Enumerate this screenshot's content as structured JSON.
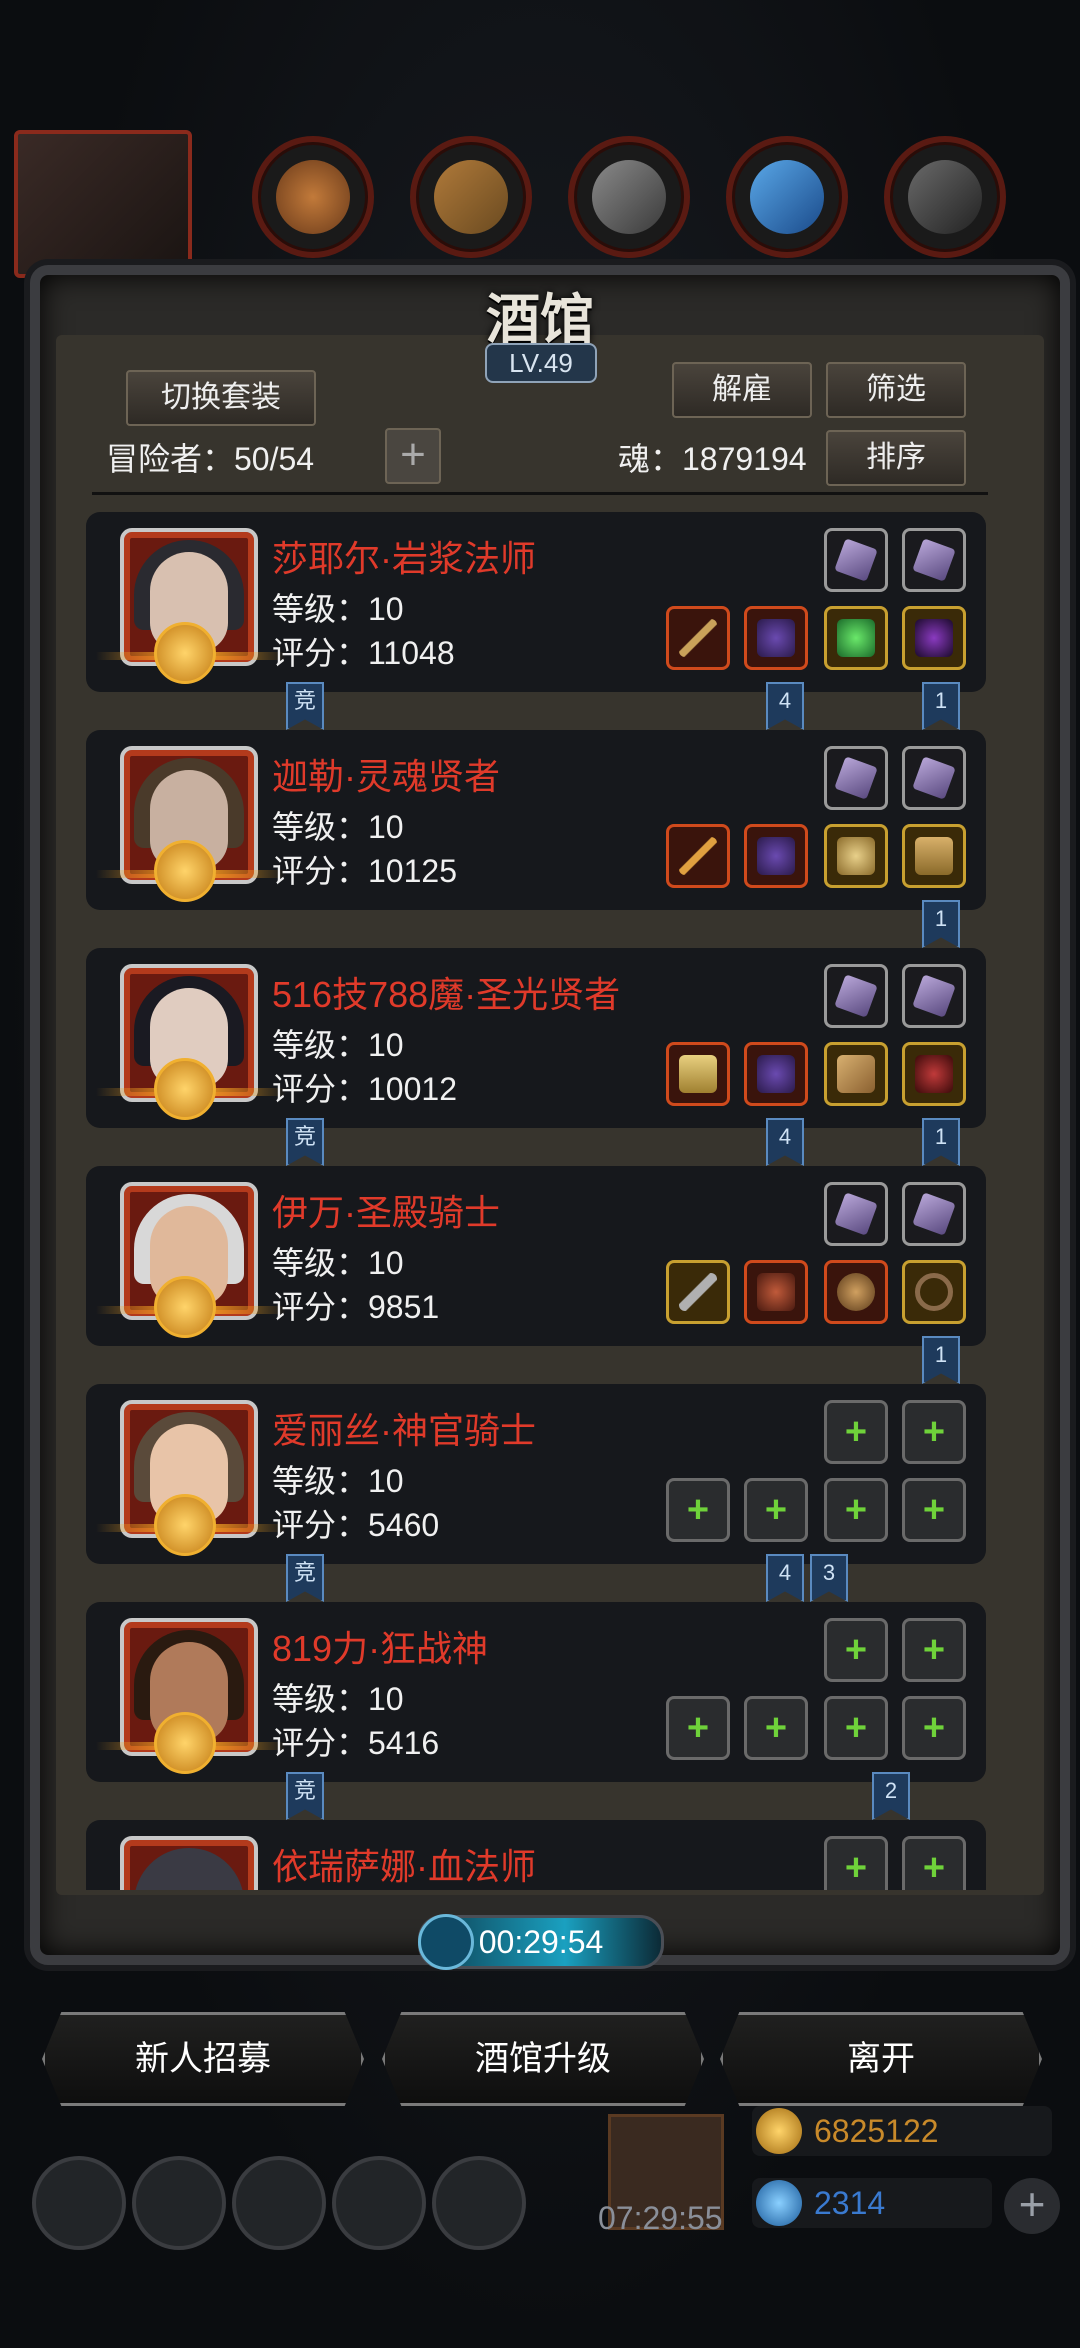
{
  "panel": {
    "title": "酒馆",
    "level": "LV.49",
    "switch_outfit": "切换套装",
    "dismiss": "解雇",
    "filter": "筛选",
    "sort": "排序",
    "adventurers_label": "冒险者：50/54",
    "soul_label": "魂：1879194"
  },
  "heroes": [
    {
      "name": "莎耶尔·岩浆法师",
      "level": "等级：10",
      "score": "评分：11048",
      "tags": [
        "竞",
        "4",
        "1"
      ]
    },
    {
      "name": "迦勒·灵魂贤者",
      "level": "等级：10",
      "score": "评分：10125",
      "tags": [
        "1"
      ]
    },
    {
      "name": "516技788魔·圣光贤者",
      "level": "等级：10",
      "score": "评分：10012",
      "tags": [
        "竞",
        "4",
        "1"
      ]
    },
    {
      "name": "伊万·圣殿骑士",
      "level": "等级：10",
      "score": "评分：9851",
      "tags": [
        "1"
      ]
    },
    {
      "name": "爱丽丝·神官骑士",
      "level": "等级：10",
      "score": "评分：5460",
      "tags": [
        "竞",
        "4",
        "3"
      ]
    },
    {
      "name": "819力·狂战神",
      "level": "等级：10",
      "score": "评分：5416",
      "tags": [
        "竞",
        "2"
      ]
    },
    {
      "name": "依瑞萨娜·血法师",
      "level": "",
      "score": "",
      "tags": []
    }
  ],
  "timer": "00:29:54",
  "buttons": {
    "recruit": "新人招募",
    "upgrade": "酒馆升级",
    "leave": "离开"
  },
  "bottom": {
    "time": "07:29:55",
    "gold": "6825122",
    "gems": "2314"
  },
  "colors": {
    "hero_name": "#e03a2a",
    "gold_text": "#c98a2a",
    "gem_text": "#3a7ad0"
  }
}
